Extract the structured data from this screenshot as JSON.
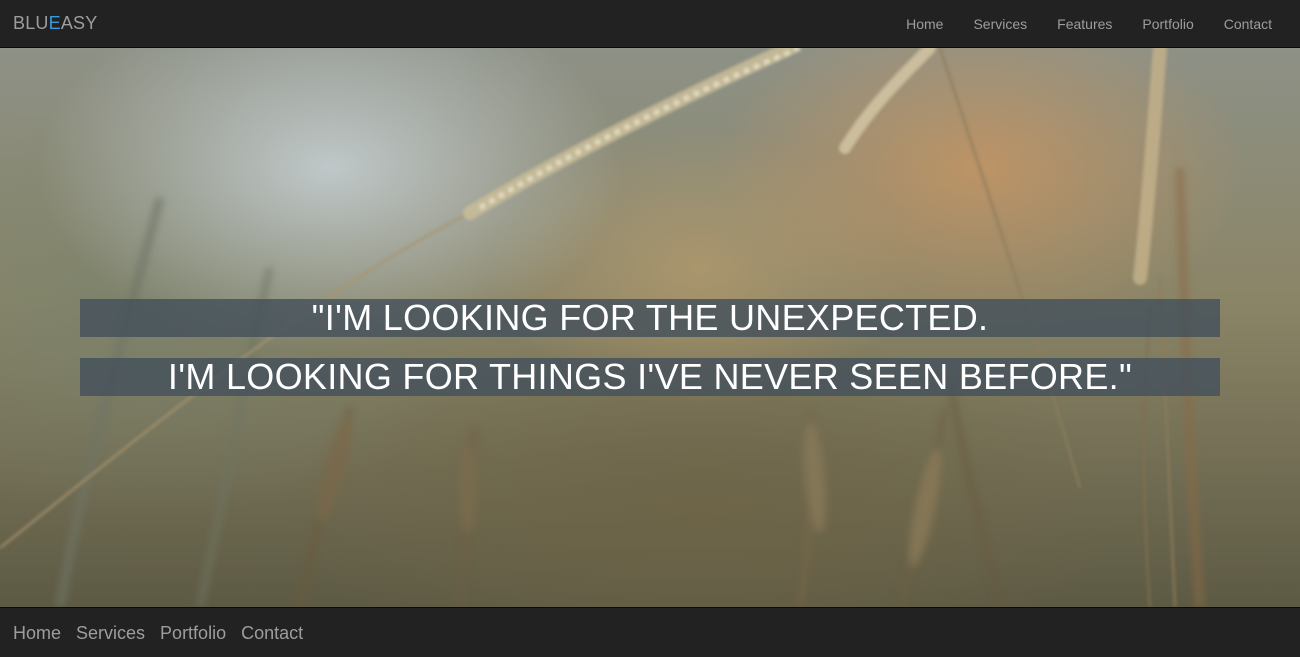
{
  "header": {
    "brand_part1": "BLU",
    "brand_part2": "E",
    "brand_part3": "ASY",
    "nav": [
      "Home",
      "Services",
      "Features",
      "Portfolio",
      "Contact"
    ]
  },
  "hero": {
    "quote_line1": "\"I'M LOOKING FOR THE UNEXPECTED.",
    "quote_line2": "I'M LOOKING FOR THINGS I'VE NEVER SEEN BEFORE.\"",
    "background": "wheat-field-photo"
  },
  "footer": {
    "nav": [
      "Home",
      "Services",
      "Portfolio",
      "Contact"
    ]
  },
  "colors": {
    "bar": "#222222",
    "nav_text": "#9d9d9d",
    "brand_accent": "#3a9ad9",
    "quote_bg": "#44505c",
    "quote_text": "#ffffff"
  }
}
